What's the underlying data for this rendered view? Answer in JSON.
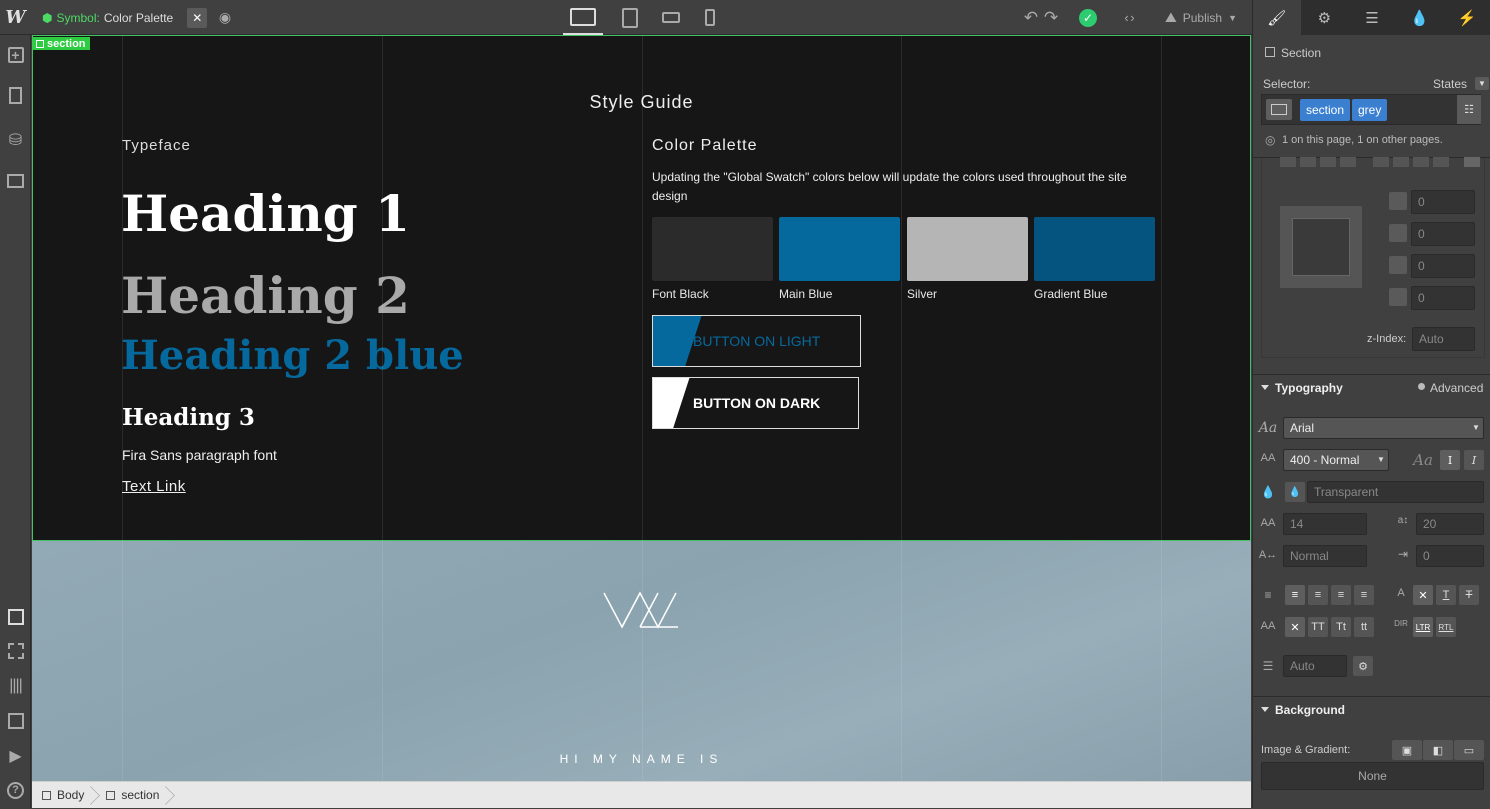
{
  "topbar": {
    "logo": "W",
    "symbol_prefix": "Symbol:",
    "symbol_name": "Color Palette",
    "close": "✕",
    "publish": "Publish",
    "code_icon": "‹ ›"
  },
  "canvas": {
    "section_label": "section",
    "style_guide_title": "Style Guide",
    "typeface_label": "Typeface",
    "heading1": "Heading 1",
    "heading2": "Heading 2",
    "heading2_blue": "Heading 2 blue",
    "heading3": "Heading 3",
    "paragraph": "Fira Sans paragraph font",
    "text_link": "Text Link",
    "palette_label": "Color Palette",
    "palette_desc": "Updating the \"Global Swatch\" colors below will update the colors used throughout the site design",
    "swatches": [
      {
        "name": "Font Black",
        "color": "#2b2b2b"
      },
      {
        "name": "Main Blue",
        "color": "#06699e"
      },
      {
        "name": "Silver",
        "color": "#b5b5b5"
      },
      {
        "name": "Gradient Blue",
        "color": "#04547f"
      }
    ],
    "button_light": "BUTTON ON LIGHT",
    "button_dark": "BUTTON ON DARK",
    "hero_text": "HI MY NAME IS"
  },
  "breadcrumbs": [
    "Body",
    "section"
  ],
  "panel": {
    "element_name": "Section",
    "selector_label": "Selector:",
    "states_label": "States",
    "classes": [
      "section",
      "grey"
    ],
    "usage_note": "1 on this page, 1 on other pages.",
    "spacing_values": [
      "0",
      "0",
      "0",
      "0"
    ],
    "zindex_label": "z-Index:",
    "zindex_placeholder": "Auto",
    "typography_header": "Typography",
    "advanced_label": "Advanced",
    "font_family": "Arial",
    "font_weight": "400 - Normal",
    "color_value": "Transparent",
    "font_size": "14",
    "line_height": "20",
    "letter_spacing": "Normal",
    "text_indent": "0",
    "case_options": [
      "TT",
      "Tt",
      "tt"
    ],
    "dir_ltr": "LTR",
    "dir_rtl": "RTL",
    "dir_label": "DIR",
    "columns_placeholder": "Auto",
    "background_header": "Background",
    "image_gradient_label": "Image & Gradient:",
    "bg_none": "None",
    "accent": "#3b7fd1"
  }
}
